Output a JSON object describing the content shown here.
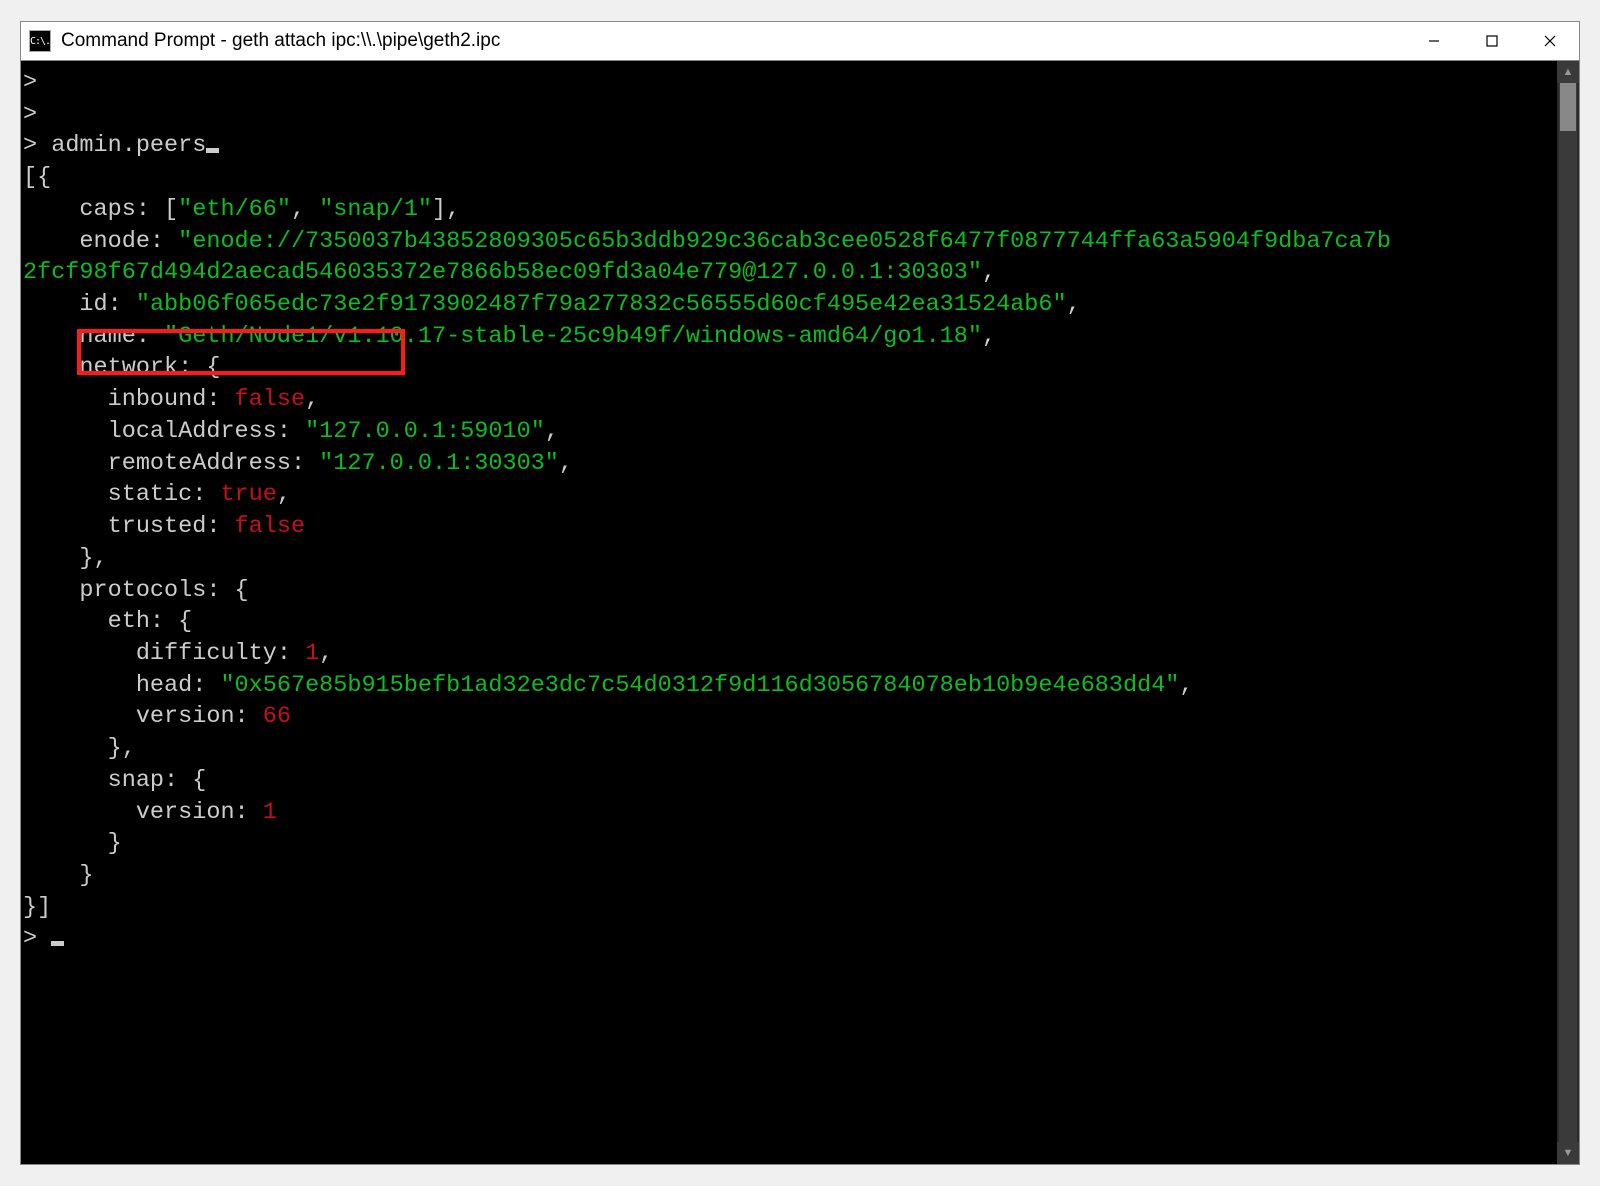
{
  "window": {
    "title": "Command Prompt - geth  attach ipc:\\\\.\\pipe\\geth2.ipc",
    "app_icon_text": "C:\\."
  },
  "terminal": {
    "prompt": ">",
    "command": "admin.peers",
    "caps_key": "caps: ",
    "caps_val1": "\"eth/66\"",
    "caps_sep": ", ",
    "caps_val2": "\"snap/1\"",
    "enode_key": "enode: ",
    "enode_val": "\"enode://7350037b43852809305c65b3ddb929c36cab3cee0528f6477f0877744ffa63a5904f9dba7ca7b2fcf98f67d494d2aecad546035372e7866b58ec09fd3a04e779@127.0.0.1:30303\"",
    "id_key": "id: ",
    "id_val": "\"abb06f065edc73e2f9173902487f79a277832c56555d60cf495e42ea31524ab6\"",
    "name_key": "name: ",
    "name_val": "\"Geth/Node1/v1.10.17-stable-25c9b49f/windows-amd64/go1.18\"",
    "network_key": "network: {",
    "inbound_key": "inbound: ",
    "inbound_val": "false",
    "localaddr_key": "localAddress: ",
    "localaddr_val": "\"127.0.0.1:59010\"",
    "remoteaddr_key": "remoteAddress: ",
    "remoteaddr_val": "\"127.0.0.1:30303\"",
    "static_key": "static: ",
    "static_val": "true",
    "trusted_key": "trusted: ",
    "trusted_val": "false",
    "protocols_key": "protocols: {",
    "eth_key": "eth: {",
    "difficulty_key": "difficulty: ",
    "difficulty_val": "1",
    "head_key": "head: ",
    "head_val": "\"0x567e85b915befb1ad32e3dc7c54d0312f9d116d3056784078eb10b9e4e683dd4\"",
    "version_key": "version: ",
    "eth_version_val": "66",
    "snap_key": "snap: {",
    "snap_version_val": "1",
    "close_brace": "}",
    "close_array": "}]",
    "open_array": "[{",
    "open_bracket": "[",
    "close_bracket": "]",
    "comma": ","
  }
}
